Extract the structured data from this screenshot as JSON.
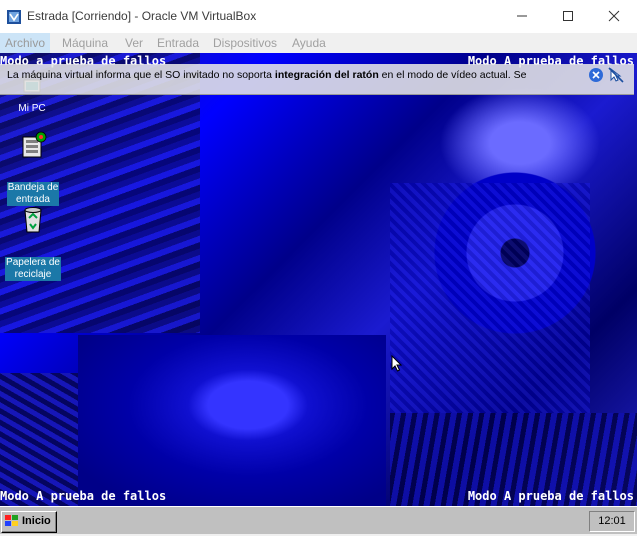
{
  "window": {
    "title": "Estrada [Corriendo] - Oracle VM VirtualBox",
    "minimize_glyph": "—",
    "maximize_glyph": "☐",
    "close_glyph": "✕"
  },
  "menu": {
    "items": [
      "Archivo",
      "Máquina",
      "Ver",
      "Entrada",
      "Dispositivos",
      "Ayuda"
    ]
  },
  "guest": {
    "safe_mode_top_left": "Modo a prueba de fallos",
    "safe_mode_top_right": "Modo A prueba de fallos",
    "safe_mode_bottom_left": "Modo A prueba de fallos",
    "safe_mode_bottom_right": "Modo A prueba de fallos",
    "notification": {
      "text_before": "La máquina virtual informa que el SO invitado no soporta ",
      "text_bold": "integración del ratón",
      "text_after": " en el modo de vídeo actual. Se"
    },
    "desktop_icons": [
      {
        "label": "Mi PC",
        "icon": "computer-icon"
      },
      {
        "label_line1": "Bandeja de",
        "label_line2": "entrada",
        "icon": "inbox-icon"
      },
      {
        "label_line1": "Papelera de",
        "label_line2": "reciclaje",
        "icon": "recycle-bin-icon"
      }
    ],
    "taskbar": {
      "start_label": "Inicio",
      "clock": "12:01"
    }
  },
  "colors": {
    "desktop_blue": "#0000ff",
    "taskbar_gray": "#c0c0c0",
    "icon_label_bg": "#1b78a8"
  }
}
